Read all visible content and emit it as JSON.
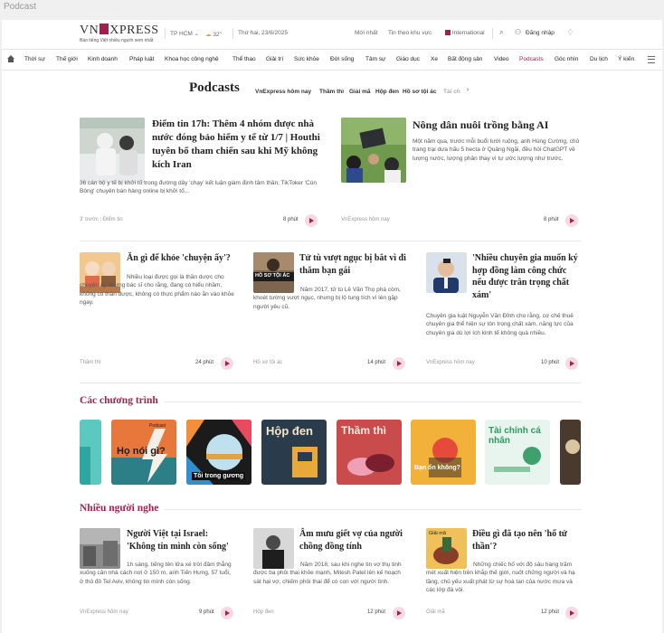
{
  "window": {
    "tab_title": "Podcast"
  },
  "header": {
    "logo_left": "VN",
    "logo_right": "XPRESS",
    "slogan": "Báo tiếng Việt nhiều người xem nhất",
    "location": "TP HCM",
    "temperature": "32",
    "date": "Thứ hai, 23/6/2025",
    "latest": "Mới nhất",
    "region_news": "Tin theo khu vực",
    "international": "International",
    "login": "Đăng nhập"
  },
  "nav": {
    "items": [
      "Thời sự",
      "Thế giới",
      "Kinh doanh",
      "Pháp luật",
      "Khoa học công nghệ",
      "Thể thao",
      "Giải trí",
      "Sức khỏe",
      "Đời sống",
      "Tâm sự",
      "Giáo dục",
      "Xe",
      "Bất động sản",
      "Video",
      "Podcasts",
      "Góc nhìn",
      "Du lịch",
      "Ý kiến"
    ],
    "active": "Podcasts"
  },
  "podcasts": {
    "title": "Podcasts",
    "tabs": [
      "VnExpress hôm nay",
      "Thầm thì",
      "Giải mã",
      "Hộp đen",
      "Hồ sơ tội ác",
      "Tài ch"
    ]
  },
  "featured": [
    {
      "title": "Điểm tin 17h: Thêm 4 nhóm được nhà nước đóng bảo hiểm y tế từ 1/7 | Houthi tuyên bố tham chiến sau khi Mỹ không kích Iran",
      "desc": "36 cán bộ y tế bị khởi tố trong đường dây 'chạy' kết luận giám định tâm thần; TikToker 'Cún Bông' chuyên bán hàng online bị khởi tố...",
      "time": "3' trước",
      "category": "Điểm tin",
      "duration": "8 phút"
    },
    {
      "title": "Nông dân nuôi trồng bằng AI",
      "desc": "Một năm qua, trước mỗi buổi tưới ruộng, anh Hùng Cường, chủ trang trại dưa hấu 5 hecta ở Quảng Ngãi, đều hỏi ChatGPT về lượng nước, lượng phân thay vì tự ước lượng như trước.",
      "category": "VnExpress hôm nay",
      "duration": "8 phút"
    }
  ],
  "row2": [
    {
      "title": "Ăn gì để khỏe 'chuyện ấy'?",
      "desc": "Nhiều loại được gọi là thần dược cho chuyện ấy nhưng bác sĩ cho rằng, đang có hiểu nhầm, không có thần dược, không có thực phẩm nào ăn vào khỏe ngay.",
      "category": "Thầm thì",
      "duration": "24 phút"
    },
    {
      "title": "Tử tù vượt ngục bị bắt vì đi thăm bạn gái",
      "desc": "Năm 2017, tử tù Lê Văn Thọ phá còm, khoét tường vượt ngục, nhưng bị lộ tung tích vì lén gặp người yêu cũ.",
      "category": "Hồ sơ tội ác",
      "duration": "14 phút",
      "thumb_text": "HỒ SƠ TỘI ÁC"
    },
    {
      "title": "'Nhiều chuyên gia muốn ký hợp đồng làm công chức nếu được trân trọng chất xám'",
      "desc": "Chuyên gia luật Nguyễn Văn Đỉnh cho rằng, cơ chế thuê chuyên gia thể hiện sự tôn trọng chất xám, năng lực của chuyên gia dù lợi ích kinh tế không quá nhiều.",
      "category": "VnExpress hôm nay",
      "duration": "10 phút"
    }
  ],
  "programs": {
    "title": "Các chương trình",
    "items": [
      {
        "name": "Họ nói gì?",
        "badge": "Podcast"
      },
      {
        "name": "Tôi trong gương"
      },
      {
        "name": "Hộp đen"
      },
      {
        "name": "Thầm thì"
      },
      {
        "name": "Bạn ổn không?"
      },
      {
        "name": "Tài chính cá nhân"
      }
    ]
  },
  "popular": {
    "title": "Nhiều người nghe",
    "items": [
      {
        "title": "Người Việt tại Israel: 'Không tin mình còn sống'",
        "desc": "1h sáng, tiếng tên lửa xé trời đâm thẳng xuống căn nhà cách nơi ở 150 m, anh Tiến Hưng, 57 tuổi, ở thủ đô Tel Aviv, không tin mình còn sống.",
        "category": "VnExpress hôm nay",
        "duration": "9 phút"
      },
      {
        "title": "Âm mưu giết vợ của người chồng đồng tính",
        "desc": "Năm 2018, sau khi nghe tin vợ thụ tinh được ba phôi thai khỏe mạnh, Mitesh Patel lên kế hoạch sát hại vợ, chiếm phôi thai để có con với người tình.",
        "category": "Hộp đen",
        "duration": "12 phút"
      },
      {
        "title": "Điều gì đã tạo nên 'hố tử thần'?",
        "desc": "Những chiếc hố với độ sâu hàng trăm mét xuất hiện trên khắp thế giới, nuốt chửng người và hạ tầng, chủ yếu xuất phát từ sự hoà tan của nước mưa và các lớp đá vôi.",
        "category": "Giải mã",
        "duration": "12 phút",
        "thumb_text": "Giải mã"
      }
    ]
  }
}
